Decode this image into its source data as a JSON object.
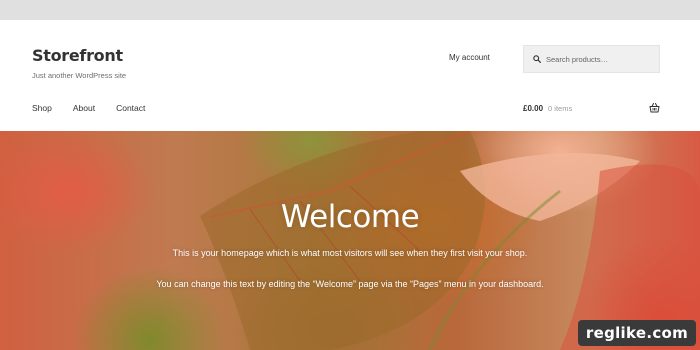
{
  "site": {
    "title": "Storefront",
    "description": "Just another WordPress site"
  },
  "header": {
    "account_link": "My account",
    "search_placeholder": "Search products…"
  },
  "nav": {
    "items": [
      {
        "label": "Shop"
      },
      {
        "label": "About"
      },
      {
        "label": "Contact"
      }
    ]
  },
  "cart": {
    "amount": "£0.00",
    "count": "0 items"
  },
  "hero": {
    "heading": "Welcome",
    "paragraph_1": "This is your homepage which is what most visitors will see when they first visit your shop.",
    "paragraph_2": "You can change this text by editing the “Welcome” page via the “Pages” menu in your dashboard."
  },
  "watermark": {
    "text": "reglike.com"
  },
  "icons": {
    "search": "search-icon",
    "cart": "shopping-basket-icon"
  },
  "colors": {
    "topbar": "#e0e0e0",
    "text": "#333333",
    "search_bg": "#f0f0f0",
    "badge_bg": "#3a3a3a"
  }
}
